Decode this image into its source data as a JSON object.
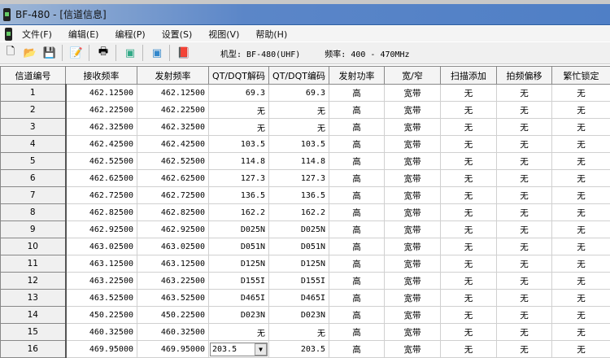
{
  "window": {
    "title": "BF-480 - [信道信息]"
  },
  "menu": [
    "文件(F)",
    "编辑(E)",
    "编程(P)",
    "设置(S)",
    "视图(V)",
    "帮助(H)"
  ],
  "toolbar": {
    "model_label": "机型: BF-480(UHF)",
    "freq_label": "频率: 400 - 470MHz",
    "icons": [
      "new-file-icon",
      "open-folder-icon",
      "save-icon",
      "edit-icon",
      "print-icon",
      "read-radio-icon",
      "write-radio-icon",
      "book-icon"
    ]
  },
  "table": {
    "headers": [
      "信道编号",
      "接收频率",
      "发射频率",
      "QT/DQT解码",
      "QT/DQT编码",
      "发射功率",
      "宽/窄",
      "扫描添加",
      "拍频偏移",
      "繁忙锁定"
    ],
    "rows": [
      [
        "1",
        "462.12500",
        "462.12500",
        "69.3",
        "69.3",
        "高",
        "宽带",
        "无",
        "无",
        "无"
      ],
      [
        "2",
        "462.22500",
        "462.22500",
        "无",
        "无",
        "高",
        "宽带",
        "无",
        "无",
        "无"
      ],
      [
        "3",
        "462.32500",
        "462.32500",
        "无",
        "无",
        "高",
        "宽带",
        "无",
        "无",
        "无"
      ],
      [
        "4",
        "462.42500",
        "462.42500",
        "103.5",
        "103.5",
        "高",
        "宽带",
        "无",
        "无",
        "无"
      ],
      [
        "5",
        "462.52500",
        "462.52500",
        "114.8",
        "114.8",
        "高",
        "宽带",
        "无",
        "无",
        "无"
      ],
      [
        "6",
        "462.62500",
        "462.62500",
        "127.3",
        "127.3",
        "高",
        "宽带",
        "无",
        "无",
        "无"
      ],
      [
        "7",
        "462.72500",
        "462.72500",
        "136.5",
        "136.5",
        "高",
        "宽带",
        "无",
        "无",
        "无"
      ],
      [
        "8",
        "462.82500",
        "462.82500",
        "162.2",
        "162.2",
        "高",
        "宽带",
        "无",
        "无",
        "无"
      ],
      [
        "9",
        "462.92500",
        "462.92500",
        "D025N",
        "D025N",
        "高",
        "宽带",
        "无",
        "无",
        "无"
      ],
      [
        "10",
        "463.02500",
        "463.02500",
        "D051N",
        "D051N",
        "高",
        "宽带",
        "无",
        "无",
        "无"
      ],
      [
        "11",
        "463.12500",
        "463.12500",
        "D125N",
        "D125N",
        "高",
        "宽带",
        "无",
        "无",
        "无"
      ],
      [
        "12",
        "463.22500",
        "463.22500",
        "D155I",
        "D155I",
        "高",
        "宽带",
        "无",
        "无",
        "无"
      ],
      [
        "13",
        "463.52500",
        "463.52500",
        "D465I",
        "D465I",
        "高",
        "宽带",
        "无",
        "无",
        "无"
      ],
      [
        "14",
        "450.22500",
        "450.22500",
        "D023N",
        "D023N",
        "高",
        "宽带",
        "无",
        "无",
        "无"
      ],
      [
        "15",
        "460.32500",
        "460.32500",
        "无",
        "无",
        "高",
        "宽带",
        "无",
        "无",
        "无"
      ],
      [
        "16",
        "469.95000",
        "469.95000",
        "203.5",
        "203.5",
        "高",
        "宽带",
        "无",
        "无",
        "无"
      ]
    ],
    "editing": {
      "row": 15,
      "col": 3
    }
  }
}
